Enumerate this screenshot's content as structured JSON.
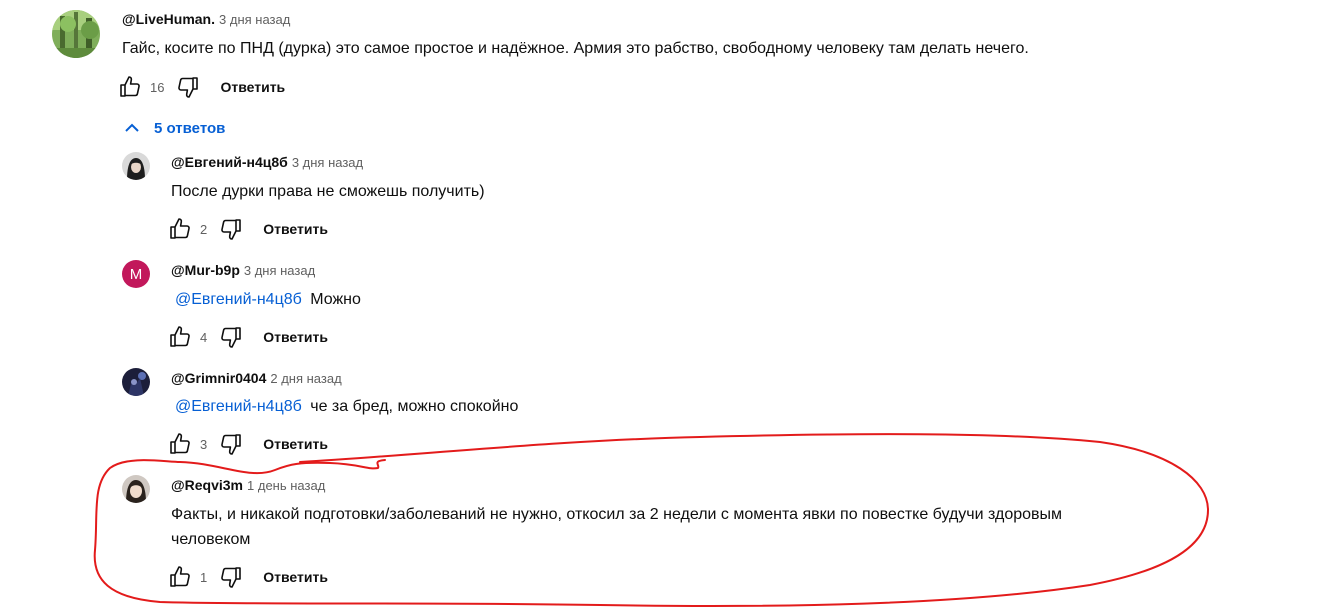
{
  "main_comment": {
    "author": "@LiveHuman.",
    "time": "3 дня назад",
    "text": "Гайс, косите по ПНД (дурка) это самое простое и надёжное. Армия это рабство, свободному человеку там делать нечего.",
    "likes": "16",
    "reply_label": "Ответить"
  },
  "replies_toggle": {
    "label": "5 ответов"
  },
  "replies": [
    {
      "author": "@Евгений-н4ц8б",
      "time": "3 дня назад",
      "mention": "",
      "text": "После дурки права не сможешь получить)",
      "text2": "",
      "likes": "2",
      "reply_label": "Ответить"
    },
    {
      "author": "@Mur-b9p",
      "time": "3 дня назад",
      "avatar_letter": "M",
      "mention": "@Евгений-н4ц8б",
      "text": "Можно",
      "text2": "",
      "likes": "4",
      "reply_label": "Ответить"
    },
    {
      "author": "@Grimnir0404",
      "time": "2 дня назад",
      "mention": "@Евгений-н4ц8б",
      "text": "че за бред, можно спокойно",
      "text2": "",
      "likes": "3",
      "reply_label": "Ответить"
    },
    {
      "author": "@Reqvi3m",
      "time": "1 день назад",
      "mention": "",
      "text": "Факты, и никакой подготовки/заболеваний не нужно, откосил за 2 недели с момента явки по повестке будучи здоровым",
      "text2": "человеком",
      "likes": "1",
      "reply_label": "Ответить"
    }
  ],
  "colors": {
    "mention": "#065fd4",
    "secondary_text": "#606060",
    "annotation_red": "#e31b1b",
    "mur_avatar": "#c2185b"
  }
}
